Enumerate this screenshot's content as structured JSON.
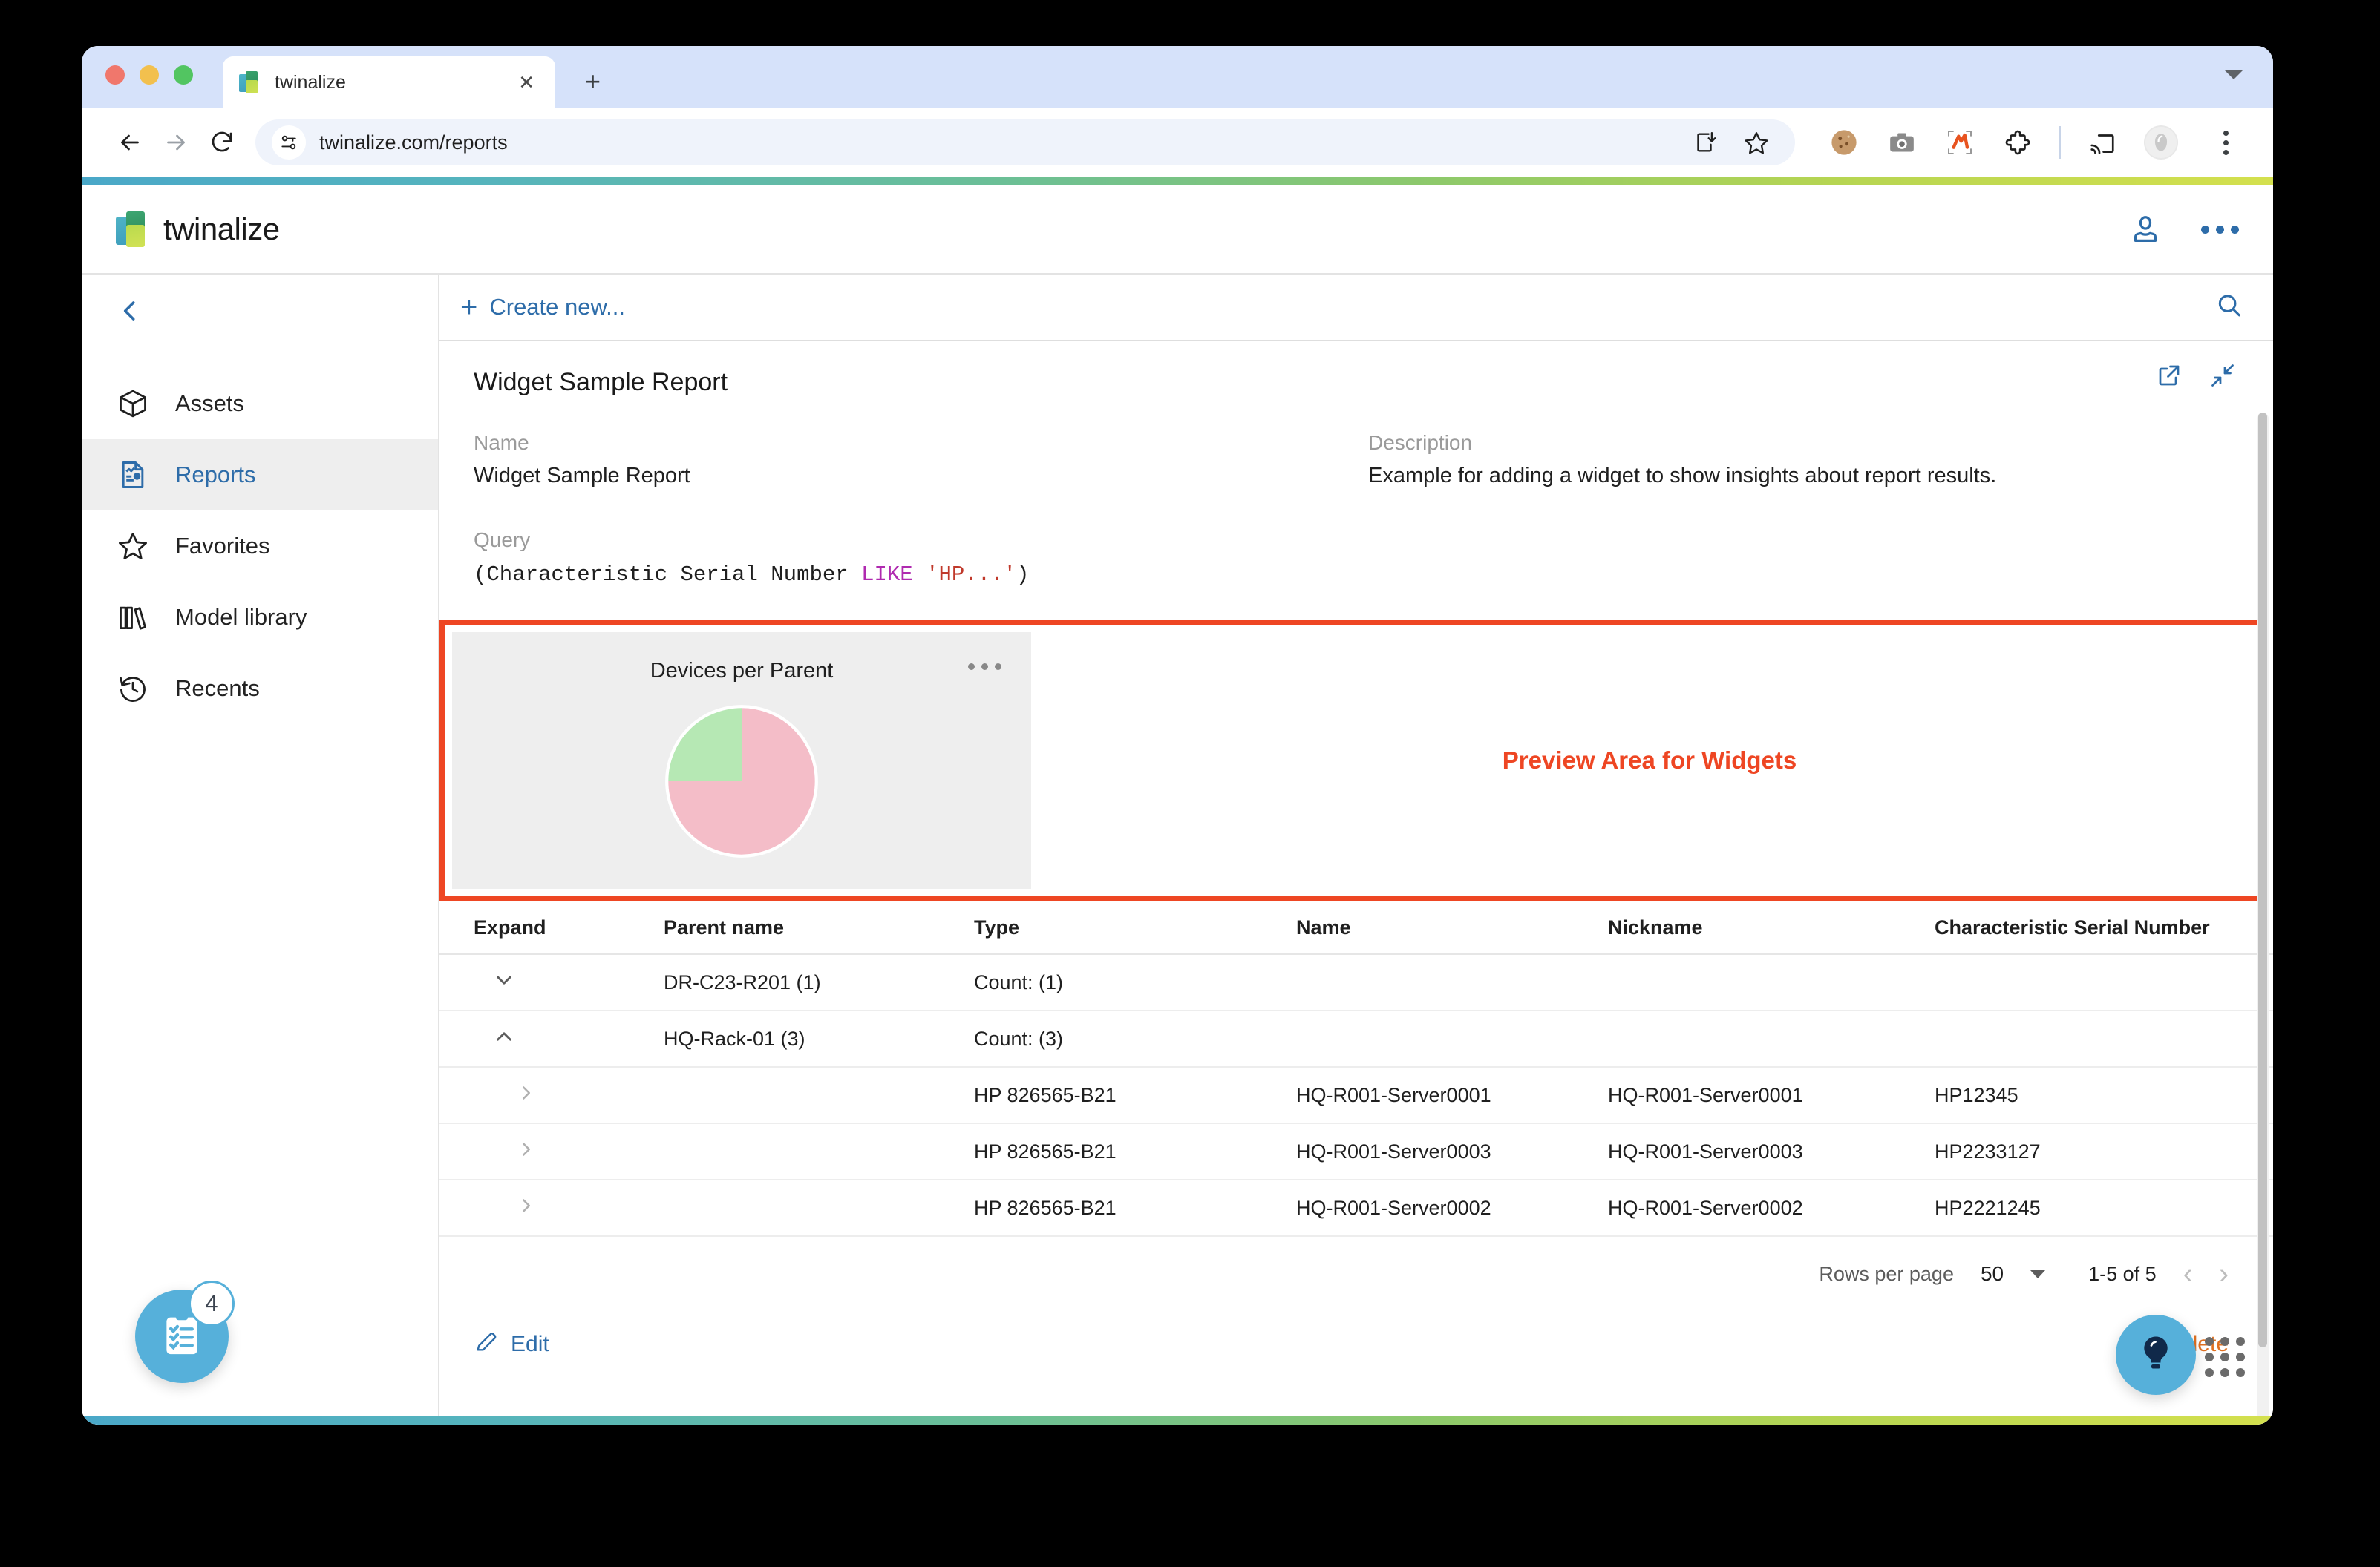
{
  "browser": {
    "tab": {
      "title": "twinalize",
      "close_label": "✕"
    },
    "new_tab_label": "+",
    "url": "twinalize.com/reports",
    "icons": {
      "back": "back-arrow-icon",
      "forward": "forward-arrow-icon",
      "reload": "reload-icon",
      "site_info": "site-info-icon",
      "install": "install-app-icon",
      "bookmark": "bookmark-star-icon",
      "cookie": "cookie-extension-icon",
      "camera": "camera-extension-icon",
      "highlight": "highlighter-extension-icon",
      "puzzle": "extensions-puzzle-icon",
      "cast": "cast-icon",
      "profile": "profile-avatar-icon",
      "menu": "chrome-menu-icon"
    }
  },
  "app": {
    "brand_name": "twinalize",
    "header_icons": {
      "user": "user-account-icon",
      "more": "more-options-icon"
    },
    "accent_blue": "#2d6ca9",
    "gradient_start": "#4aa8c8",
    "gradient_end": "#d4e04e"
  },
  "sidebar": {
    "collapse_label": "‹",
    "items": [
      {
        "label": "Assets",
        "icon": "cube-icon",
        "active": false
      },
      {
        "label": "Reports",
        "icon": "report-document-icon",
        "active": true
      },
      {
        "label": "Favorites",
        "icon": "star-icon",
        "active": false
      },
      {
        "label": "Model library",
        "icon": "books-icon",
        "active": false
      },
      {
        "label": "Recents",
        "icon": "history-clock-icon",
        "active": false
      }
    ]
  },
  "content": {
    "create_new_label": "Create new...",
    "search_icon": "search-icon",
    "report": {
      "title": "Widget Sample Report",
      "actions": {
        "open_external": "open-in-new-icon",
        "collapse": "collapse-icon"
      },
      "name_label": "Name",
      "name_value": "Widget Sample Report",
      "description_label": "Description",
      "description_value": "Example for adding a widget to show insights about report results.",
      "query_label": "Query",
      "query_prefix": "(Characteristic Serial Number ",
      "query_keyword": "LIKE",
      "query_string": " 'HP...'",
      "query_suffix": ")"
    },
    "preview": {
      "annotation_label": "Preview Area for Widgets",
      "annotation_color": "#ee4623",
      "widget": {
        "title": "Devices per Parent",
        "menu_icon": "widget-more-icon"
      }
    },
    "table": {
      "columns": [
        "Expand",
        "Parent name",
        "Type",
        "Name",
        "Nickname",
        "Characteristic Serial Number"
      ],
      "rows": [
        {
          "level": "parent",
          "expand_icon": "chevron-down-icon",
          "parent": "DR-C23-R201 (1)",
          "type": "Count: (1)",
          "name": "",
          "nickname": "",
          "serial": ""
        },
        {
          "level": "parent",
          "expand_icon": "chevron-up-icon",
          "parent": "HQ-Rack-01 (3)",
          "type": "Count: (3)",
          "name": "",
          "nickname": "",
          "serial": ""
        },
        {
          "level": "child",
          "expand_icon": "chevron-right-icon",
          "parent": "",
          "type": "HP 826565-B21",
          "name": "HQ-R001-Server0001",
          "nickname": "HQ-R001-Server0001",
          "serial": "HP12345"
        },
        {
          "level": "child",
          "expand_icon": "chevron-right-icon",
          "parent": "",
          "type": "HP 826565-B21",
          "name": "HQ-R001-Server0003",
          "nickname": "HQ-R001-Server0003",
          "serial": "HP2233127"
        },
        {
          "level": "child",
          "expand_icon": "chevron-right-icon",
          "parent": "",
          "type": "HP 826565-B21",
          "name": "HQ-R001-Server0002",
          "nickname": "HQ-R001-Server0002",
          "serial": "HP2221245"
        }
      ]
    },
    "pagination": {
      "rows_per_page_label": "Rows per page",
      "rows_per_page_value": "50",
      "range_text": "1-5 of 5",
      "prev_label": "‹",
      "next_label": "›"
    },
    "footer": {
      "edit_label": "Edit",
      "edit_icon": "pencil-icon",
      "delete_label": "Delete",
      "delete_color": "#e07020"
    }
  },
  "floating": {
    "tasks": {
      "icon": "clipboard-checklist-icon",
      "badge": "4",
      "color": "#56b0da"
    },
    "help": {
      "icon": "lightbulb-icon",
      "color": "#56b0da"
    },
    "drag_handle": {
      "icon": "grid-dots-icon"
    }
  },
  "chart_data": {
    "type": "pie",
    "title": "Devices per Parent",
    "labels": [
      "DR-C23-R201",
      "HQ-Rack-01"
    ],
    "values": [
      1,
      3
    ],
    "percentages": [
      25,
      75
    ],
    "colors": [
      "#b6e8b4",
      "#f4bdc8"
    ],
    "legend": "none",
    "start_angle_deg": 0,
    "direction": "counterclockwise"
  }
}
